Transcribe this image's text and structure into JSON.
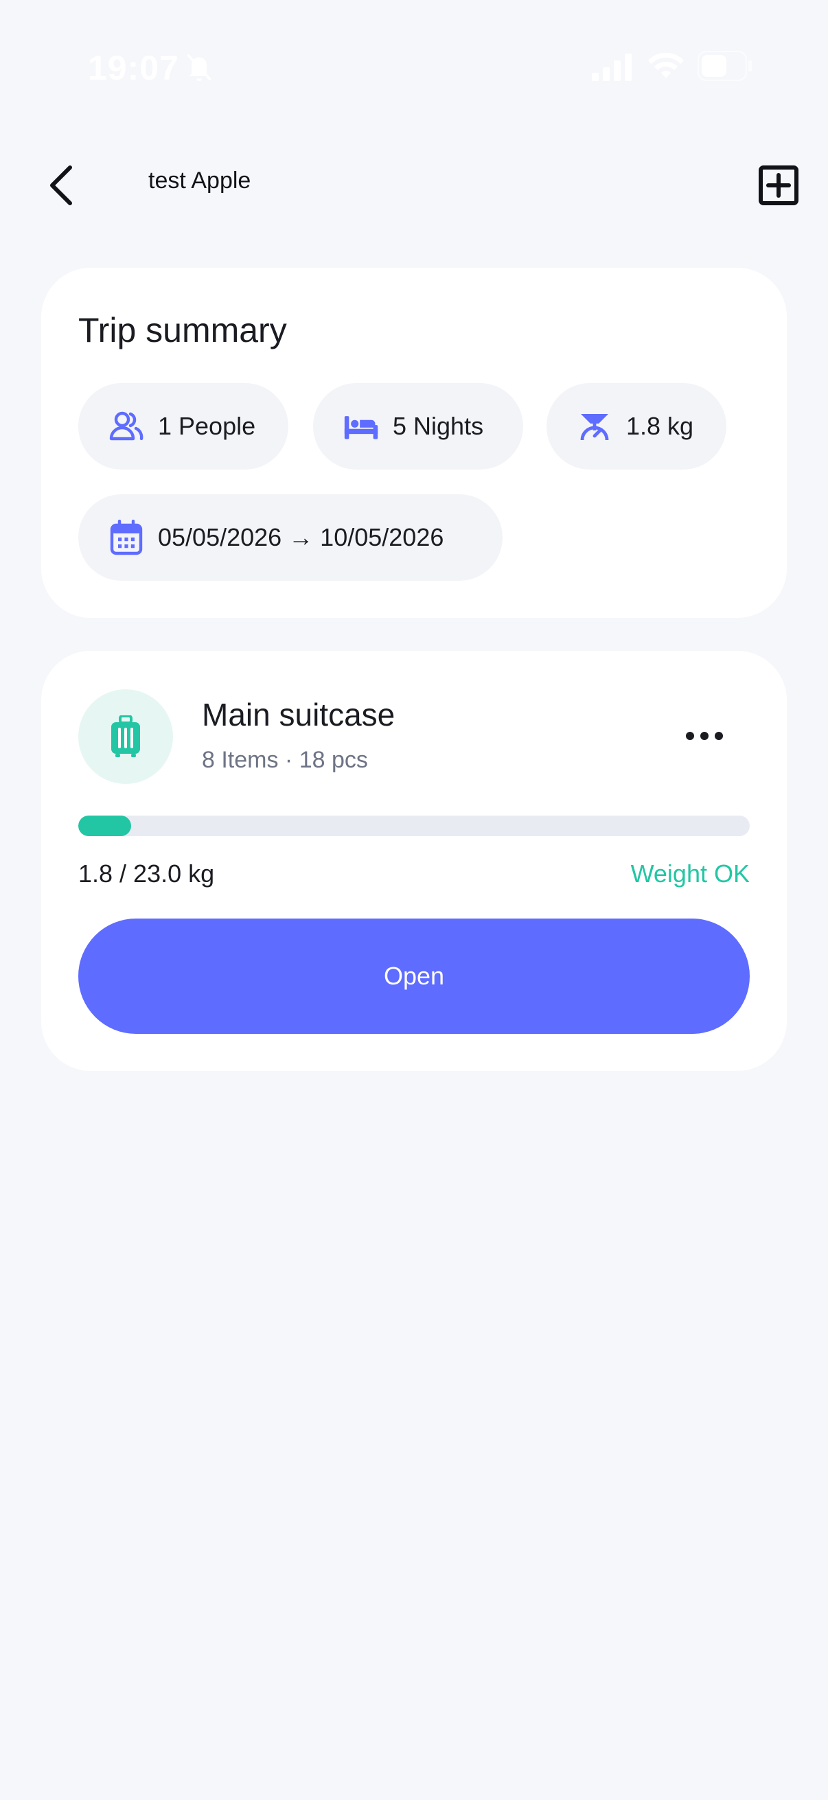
{
  "status_bar": {
    "time": "19:07",
    "icons": [
      "bell-slash-icon",
      "cellular-signal-icon",
      "wifi-icon",
      "battery-icon"
    ]
  },
  "header": {
    "title": "test Apple",
    "back_icon": "chevron-left-icon",
    "add_icon": "plus-square-icon"
  },
  "trip_summary": {
    "title": "Trip summary",
    "chips": {
      "people": {
        "icon": "people-icon",
        "label": "1 People"
      },
      "nights": {
        "icon": "bed-icon",
        "label": "5 Nights"
      },
      "weight": {
        "icon": "scale-icon",
        "label": "1.8 kg"
      },
      "dates": {
        "icon": "calendar-icon",
        "label": "05/05/2026 → 10/05/2026"
      }
    }
  },
  "suitcase": {
    "icon": "suitcase-icon",
    "name": "Main suitcase",
    "meta": "8 Items · 18 pcs",
    "weight_text": "1.8 / 23.0 kg",
    "weight_current": 1.8,
    "weight_max": 23.0,
    "status": "Weight OK",
    "open_label": "Open",
    "more_icon": "more-horizontal-icon"
  },
  "colors": {
    "background": "#F6F7FB",
    "accent": "#5E6CFF",
    "success": "#23C6A4",
    "chip": "#F3F4F8"
  }
}
